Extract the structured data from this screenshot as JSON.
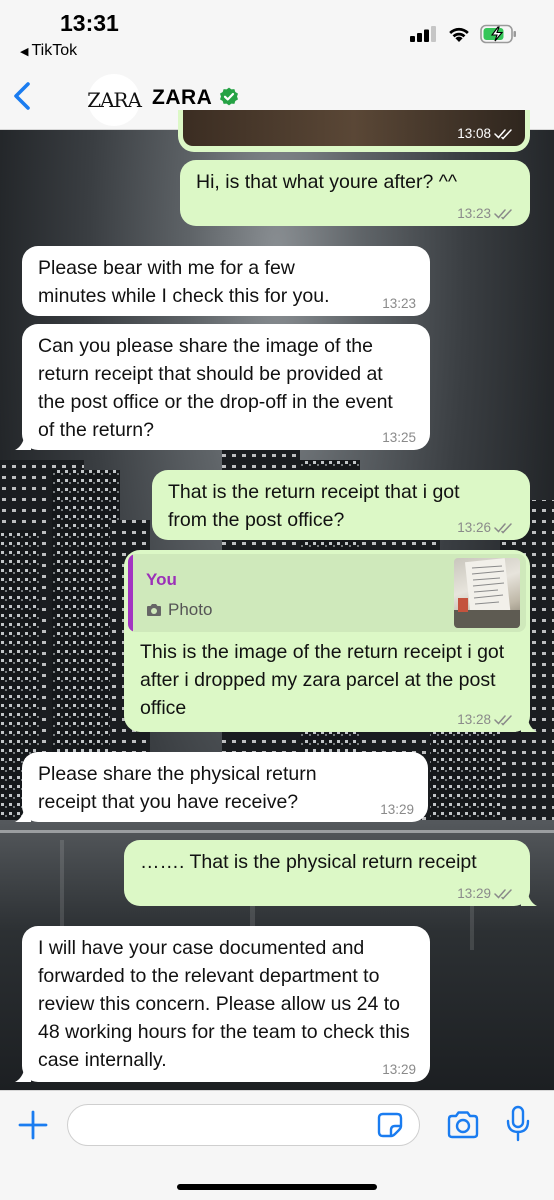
{
  "status_bar": {
    "time": "13:31",
    "back_app": "TikTok"
  },
  "header": {
    "avatar_text": "ZARA",
    "contact_name": "ZARA",
    "verified": true
  },
  "colors": {
    "incoming_bubble": "#ffffff",
    "outgoing_bubble": "#dcf8c6",
    "accent_blue": "#1a7cf0",
    "reply_author": "#9b30b8",
    "verified_green": "#25a244"
  },
  "messages": [
    {
      "direction": "out",
      "text": "",
      "time": "13:08",
      "read": true
    },
    {
      "direction": "out",
      "text": "Hi, is that what youre after? ^^",
      "time": "13:23",
      "read": true
    },
    {
      "direction": "in",
      "text": "Please bear with me for a few minutes while I check this for you.",
      "time": "13:23"
    },
    {
      "direction": "in",
      "text": "Can you please share the image of the return receipt that should be provided at the post office or the drop-off in the event of the return?",
      "time": "13:25"
    },
    {
      "direction": "out",
      "text": "That is the return receipt that i got from the post office?",
      "time": "13:26",
      "read": true
    },
    {
      "direction": "out",
      "reply_to": {
        "author": "You",
        "kind": "Photo"
      },
      "text": "This is the image of the return receipt i got after i dropped my zara parcel at the post office",
      "time": "13:28",
      "read": true
    },
    {
      "direction": "in",
      "text": "Please share the physical return receipt that you have receive?",
      "time": "13:29"
    },
    {
      "direction": "out",
      "text": "……. That is the physical return receipt",
      "time": "13:29",
      "read": true
    },
    {
      "direction": "in",
      "text": "I will have your case documented and forwarded to the relevant department to review this concern. Please allow us 24 to 48 working hours for the team to check this case internally.",
      "time": "13:29"
    }
  ],
  "input": {
    "value": "",
    "placeholder": ""
  }
}
